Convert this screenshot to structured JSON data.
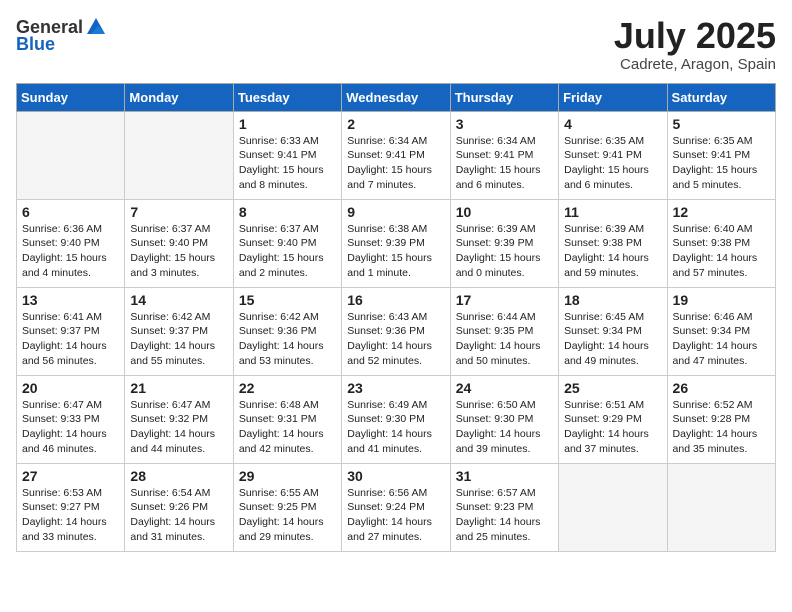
{
  "header": {
    "logo_general": "General",
    "logo_blue": "Blue",
    "month": "July 2025",
    "location": "Cadrete, Aragon, Spain"
  },
  "weekdays": [
    "Sunday",
    "Monday",
    "Tuesday",
    "Wednesday",
    "Thursday",
    "Friday",
    "Saturday"
  ],
  "weeks": [
    [
      {
        "day": "",
        "sunrise": "",
        "sunset": "",
        "daylight": ""
      },
      {
        "day": "",
        "sunrise": "",
        "sunset": "",
        "daylight": ""
      },
      {
        "day": "1",
        "sunrise": "Sunrise: 6:33 AM",
        "sunset": "Sunset: 9:41 PM",
        "daylight": "Daylight: 15 hours and 8 minutes."
      },
      {
        "day": "2",
        "sunrise": "Sunrise: 6:34 AM",
        "sunset": "Sunset: 9:41 PM",
        "daylight": "Daylight: 15 hours and 7 minutes."
      },
      {
        "day": "3",
        "sunrise": "Sunrise: 6:34 AM",
        "sunset": "Sunset: 9:41 PM",
        "daylight": "Daylight: 15 hours and 6 minutes."
      },
      {
        "day": "4",
        "sunrise": "Sunrise: 6:35 AM",
        "sunset": "Sunset: 9:41 PM",
        "daylight": "Daylight: 15 hours and 6 minutes."
      },
      {
        "day": "5",
        "sunrise": "Sunrise: 6:35 AM",
        "sunset": "Sunset: 9:41 PM",
        "daylight": "Daylight: 15 hours and 5 minutes."
      }
    ],
    [
      {
        "day": "6",
        "sunrise": "Sunrise: 6:36 AM",
        "sunset": "Sunset: 9:40 PM",
        "daylight": "Daylight: 15 hours and 4 minutes."
      },
      {
        "day": "7",
        "sunrise": "Sunrise: 6:37 AM",
        "sunset": "Sunset: 9:40 PM",
        "daylight": "Daylight: 15 hours and 3 minutes."
      },
      {
        "day": "8",
        "sunrise": "Sunrise: 6:37 AM",
        "sunset": "Sunset: 9:40 PM",
        "daylight": "Daylight: 15 hours and 2 minutes."
      },
      {
        "day": "9",
        "sunrise": "Sunrise: 6:38 AM",
        "sunset": "Sunset: 9:39 PM",
        "daylight": "Daylight: 15 hours and 1 minute."
      },
      {
        "day": "10",
        "sunrise": "Sunrise: 6:39 AM",
        "sunset": "Sunset: 9:39 PM",
        "daylight": "Daylight: 15 hours and 0 minutes."
      },
      {
        "day": "11",
        "sunrise": "Sunrise: 6:39 AM",
        "sunset": "Sunset: 9:38 PM",
        "daylight": "Daylight: 14 hours and 59 minutes."
      },
      {
        "day": "12",
        "sunrise": "Sunrise: 6:40 AM",
        "sunset": "Sunset: 9:38 PM",
        "daylight": "Daylight: 14 hours and 57 minutes."
      }
    ],
    [
      {
        "day": "13",
        "sunrise": "Sunrise: 6:41 AM",
        "sunset": "Sunset: 9:37 PM",
        "daylight": "Daylight: 14 hours and 56 minutes."
      },
      {
        "day": "14",
        "sunrise": "Sunrise: 6:42 AM",
        "sunset": "Sunset: 9:37 PM",
        "daylight": "Daylight: 14 hours and 55 minutes."
      },
      {
        "day": "15",
        "sunrise": "Sunrise: 6:42 AM",
        "sunset": "Sunset: 9:36 PM",
        "daylight": "Daylight: 14 hours and 53 minutes."
      },
      {
        "day": "16",
        "sunrise": "Sunrise: 6:43 AM",
        "sunset": "Sunset: 9:36 PM",
        "daylight": "Daylight: 14 hours and 52 minutes."
      },
      {
        "day": "17",
        "sunrise": "Sunrise: 6:44 AM",
        "sunset": "Sunset: 9:35 PM",
        "daylight": "Daylight: 14 hours and 50 minutes."
      },
      {
        "day": "18",
        "sunrise": "Sunrise: 6:45 AM",
        "sunset": "Sunset: 9:34 PM",
        "daylight": "Daylight: 14 hours and 49 minutes."
      },
      {
        "day": "19",
        "sunrise": "Sunrise: 6:46 AM",
        "sunset": "Sunset: 9:34 PM",
        "daylight": "Daylight: 14 hours and 47 minutes."
      }
    ],
    [
      {
        "day": "20",
        "sunrise": "Sunrise: 6:47 AM",
        "sunset": "Sunset: 9:33 PM",
        "daylight": "Daylight: 14 hours and 46 minutes."
      },
      {
        "day": "21",
        "sunrise": "Sunrise: 6:47 AM",
        "sunset": "Sunset: 9:32 PM",
        "daylight": "Daylight: 14 hours and 44 minutes."
      },
      {
        "day": "22",
        "sunrise": "Sunrise: 6:48 AM",
        "sunset": "Sunset: 9:31 PM",
        "daylight": "Daylight: 14 hours and 42 minutes."
      },
      {
        "day": "23",
        "sunrise": "Sunrise: 6:49 AM",
        "sunset": "Sunset: 9:30 PM",
        "daylight": "Daylight: 14 hours and 41 minutes."
      },
      {
        "day": "24",
        "sunrise": "Sunrise: 6:50 AM",
        "sunset": "Sunset: 9:30 PM",
        "daylight": "Daylight: 14 hours and 39 minutes."
      },
      {
        "day": "25",
        "sunrise": "Sunrise: 6:51 AM",
        "sunset": "Sunset: 9:29 PM",
        "daylight": "Daylight: 14 hours and 37 minutes."
      },
      {
        "day": "26",
        "sunrise": "Sunrise: 6:52 AM",
        "sunset": "Sunset: 9:28 PM",
        "daylight": "Daylight: 14 hours and 35 minutes."
      }
    ],
    [
      {
        "day": "27",
        "sunrise": "Sunrise: 6:53 AM",
        "sunset": "Sunset: 9:27 PM",
        "daylight": "Daylight: 14 hours and 33 minutes."
      },
      {
        "day": "28",
        "sunrise": "Sunrise: 6:54 AM",
        "sunset": "Sunset: 9:26 PM",
        "daylight": "Daylight: 14 hours and 31 minutes."
      },
      {
        "day": "29",
        "sunrise": "Sunrise: 6:55 AM",
        "sunset": "Sunset: 9:25 PM",
        "daylight": "Daylight: 14 hours and 29 minutes."
      },
      {
        "day": "30",
        "sunrise": "Sunrise: 6:56 AM",
        "sunset": "Sunset: 9:24 PM",
        "daylight": "Daylight: 14 hours and 27 minutes."
      },
      {
        "day": "31",
        "sunrise": "Sunrise: 6:57 AM",
        "sunset": "Sunset: 9:23 PM",
        "daylight": "Daylight: 14 hours and 25 minutes."
      },
      {
        "day": "",
        "sunrise": "",
        "sunset": "",
        "daylight": ""
      },
      {
        "day": "",
        "sunrise": "",
        "sunset": "",
        "daylight": ""
      }
    ]
  ]
}
